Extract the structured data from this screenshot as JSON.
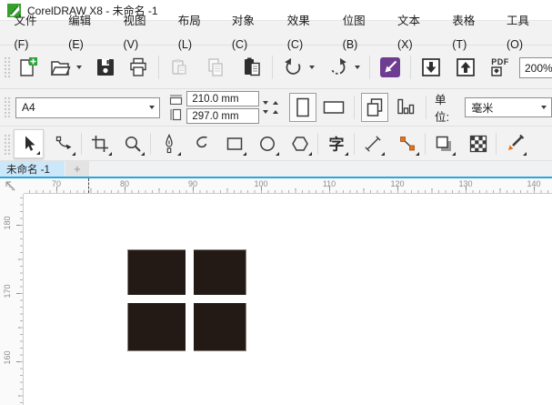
{
  "window": {
    "title": "CorelDRAW X8 - 未命名 -1",
    "app_icon": "coreldraw-logo"
  },
  "menu_bar": {
    "items": [
      "文件(F)",
      "编辑(E)",
      "视图(V)",
      "布局(L)",
      "对象(C)",
      "效果(C)",
      "位图(B)",
      "文本(X)",
      "表格(T)",
      "工具(O)"
    ]
  },
  "standard_toolbar": {
    "buttons": [
      "new-document",
      "open",
      "save",
      "print",
      "cut",
      "copy",
      "paste",
      "undo",
      "redo",
      "search-content",
      "import",
      "export",
      "publish-pdf"
    ],
    "pdf_label": "PDF",
    "zoom_level": "200%"
  },
  "property_bar": {
    "page_size_preset": "A4",
    "page_width": "210.0 mm",
    "page_height": "297.0 mm",
    "orientation_selected": "portrait",
    "units_label": "单位:",
    "units_value": "毫米"
  },
  "toolbox": {
    "selected_tool": "pick",
    "text_tool_glyph": "字",
    "tools": [
      "pick",
      "shape",
      "crop",
      "zoom",
      "pen",
      "freehand",
      "rectangle",
      "ellipse",
      "polygon",
      "text",
      "parallel-dimension",
      "connector",
      "drop-shadow",
      "transparency",
      "color-eyedropper"
    ]
  },
  "document_tabs": {
    "tabs": [
      {
        "label": "未命名 -1",
        "active": true
      }
    ],
    "add_tab_label": "+"
  },
  "rulers": {
    "units": "mm",
    "horizontal_labels": [
      "70",
      "80",
      "90",
      "100",
      "110",
      "120",
      "130",
      "140"
    ],
    "vertical_labels": [
      "180",
      "170",
      "160"
    ]
  },
  "canvas": {
    "object": {
      "type": "rectangle-with-white-cross",
      "fill": "#231A16",
      "cross_color": "#FFFFFF"
    }
  },
  "colors": {
    "accent_blue": "#2AA5DE",
    "active_tab": "#CBE7FA",
    "search_icon_purple": "#6E3D91",
    "new_doc_green": "#27A337",
    "connector_orange": "#E8721B"
  }
}
